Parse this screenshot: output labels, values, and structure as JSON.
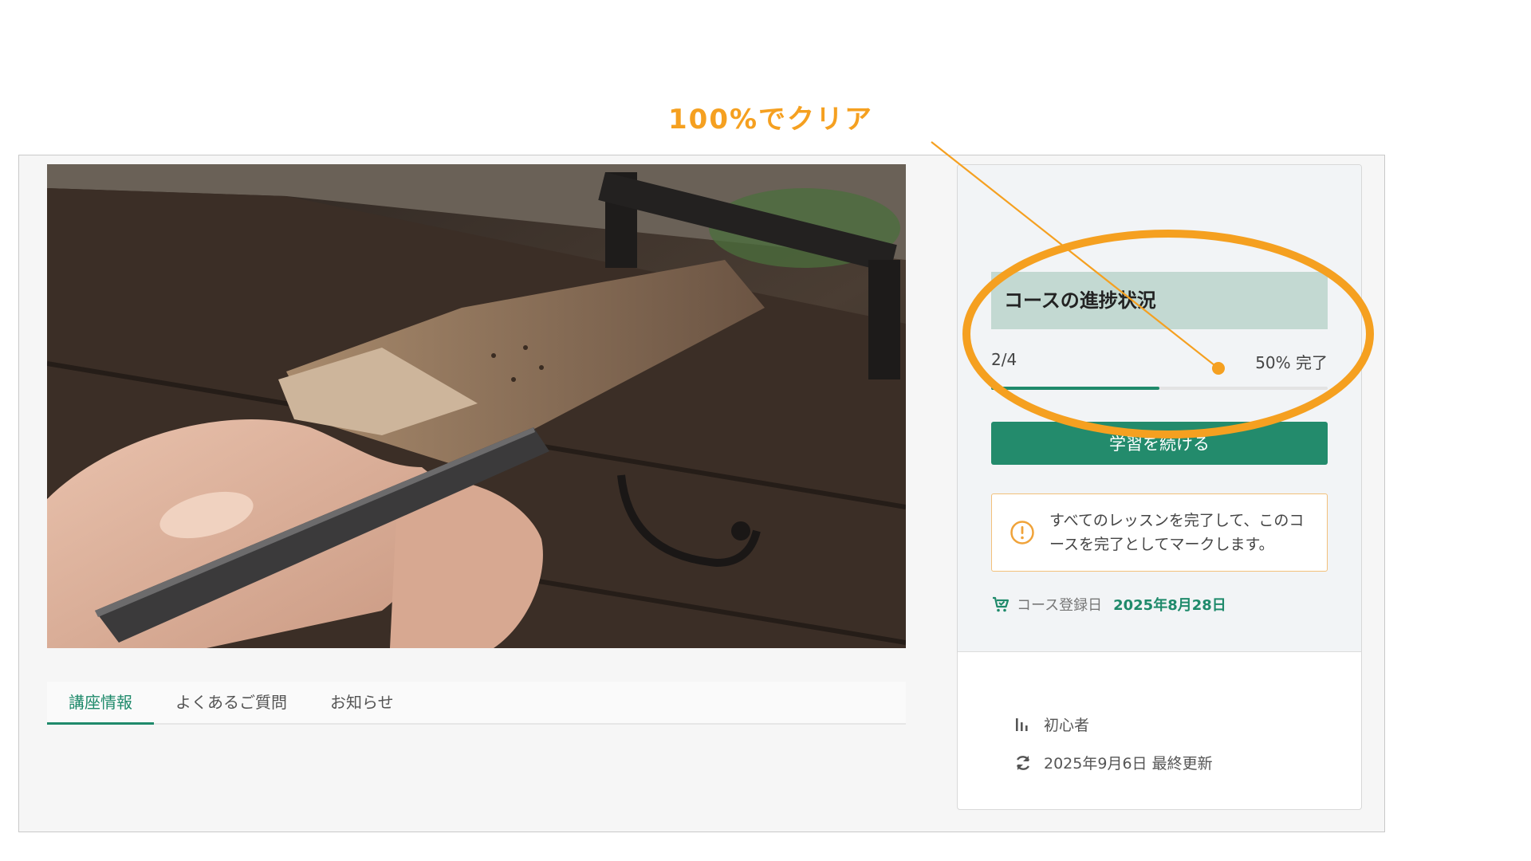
{
  "annotation": {
    "text": "100%でクリア",
    "color": "#f5a020"
  },
  "tabs": [
    {
      "label": "講座情報",
      "active": true
    },
    {
      "label": "よくあるご質問",
      "active": false
    },
    {
      "label": "お知らせ",
      "active": false
    }
  ],
  "sidebar": {
    "progress": {
      "title": "コースの進捗状況",
      "count": "2/4",
      "percent_label": "50% 完了",
      "value": 0.5
    },
    "continue_label": "学習を続ける",
    "notice": "すべてのレッスンを完了して、このコースを完了としてマークします。",
    "enroll_label": "コース登録日",
    "enroll_date": "2025年8月28日",
    "level": "初心者",
    "updated": "2025年9月6日 最終更新"
  },
  "colors": {
    "accent": "#1f8a6b",
    "button": "#238b6c",
    "notice_border": "#f2c07a",
    "title_bg": "#c3d9d2"
  },
  "icons": [
    "warning-circle-icon",
    "cart-icon",
    "level-bars-icon",
    "refresh-icon"
  ]
}
